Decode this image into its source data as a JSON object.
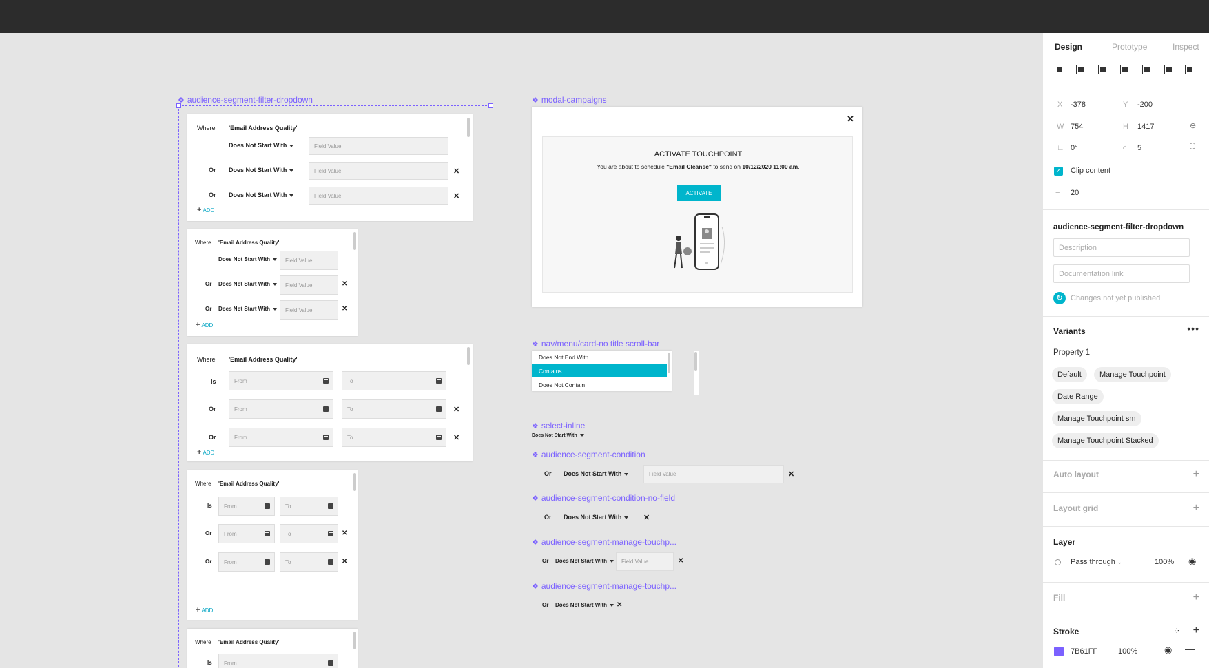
{
  "canvas": {
    "components": {
      "filter_dropdown_label": "audience-segment-filter-dropdown",
      "modal_label": "modal-campaigns",
      "nav_menu_label": "nav/menu/card-no title scroll-bar",
      "select_inline_label": "select-inline",
      "condition_label": "audience-segment-condition",
      "condition_no_field_label": "audience-segment-condition-no-field",
      "manage_touchpoint_label_1": "audience-segment-manage-touchp...",
      "manage_touchpoint_label_2": "audience-segment-manage-touchp..."
    },
    "filter": {
      "where": "Where",
      "field_name": "'Email Address Quality'",
      "or": "Or",
      "is": "Is",
      "operator": "Does Not Start With",
      "field_placeholder": "Field Value",
      "from_placeholder": "From",
      "to_placeholder": "To",
      "add": "ADD"
    },
    "modal": {
      "title": "ACTIVATE TOUCHPOINT",
      "text_pre": "You are about to schedule ",
      "campaign": "\"Email Cleanse\"",
      "text_mid": " to send on ",
      "datetime": "10/12/2020 11:00 am",
      "text_post": ".",
      "button": "ACTIVATE"
    },
    "menu": {
      "items": [
        "Does Not End With",
        "Contains",
        "Does Not Contain"
      ]
    }
  },
  "panel": {
    "tabs": [
      "Design",
      "Prototype",
      "Inspect"
    ],
    "x_label": "X",
    "x": "-378",
    "y_label": "Y",
    "y": "-200",
    "w_label": "W",
    "w": "754",
    "h_label": "H",
    "h": "1417",
    "rotation": "0°",
    "radius": "5",
    "clip_content": "Clip content",
    "spacing": "20",
    "component_name": "audience-segment-filter-dropdown",
    "description_placeholder": "Description",
    "doc_link_placeholder": "Documentation link",
    "publish_status": "Changes not yet published",
    "variants_title": "Variants",
    "property": "Property 1",
    "variants": [
      "Default",
      "Manage Touchpoint",
      "Date Range",
      "Manage Touchpoint sm",
      "Manage Touchpoint Stacked"
    ],
    "auto_layout": "Auto layout",
    "layout_grid": "Layout grid",
    "layer_title": "Layer",
    "blend_mode": "Pass through",
    "layer_opacity": "100%",
    "fill_title": "Fill",
    "stroke_title": "Stroke",
    "stroke_color": "7B61FF",
    "stroke_opacity": "100%",
    "stroke_swatch": "#7b61ff",
    "accent": "#00b5cc"
  }
}
